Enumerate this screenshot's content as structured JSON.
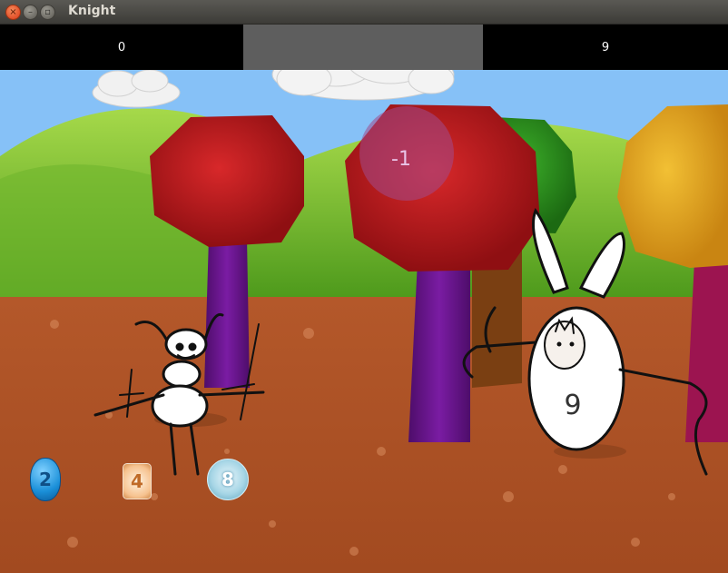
{
  "window": {
    "title": "Knight",
    "close_glyph": "×",
    "minimize_glyph": "–",
    "maximize_glyph": "▫"
  },
  "hud": {
    "left_value": "0",
    "middle_value": "",
    "right_value": "9"
  },
  "scene": {
    "floating_damage": "-1",
    "enemy_number": "9",
    "tokens": [
      {
        "value": "2",
        "kind": "blue-gem"
      },
      {
        "value": "4",
        "kind": "amber-gem"
      },
      {
        "value": "8",
        "kind": "ice-orb"
      }
    ]
  },
  "colors": {
    "sky": "#86c1f7",
    "hud_bg": "#000000",
    "hud_middle": "#5e5e5e",
    "ground": "#b4582a",
    "tree_red": "#b8191c",
    "tree_green": "#2e8f1f",
    "tree_yellow": "#e0a21a",
    "trunk_purple": "#6b1591",
    "trunk_brown": "#7a3f12",
    "trunk_magenta": "#9c1450"
  },
  "icons": [
    "close-icon",
    "minimize-icon",
    "maximize-icon"
  ]
}
